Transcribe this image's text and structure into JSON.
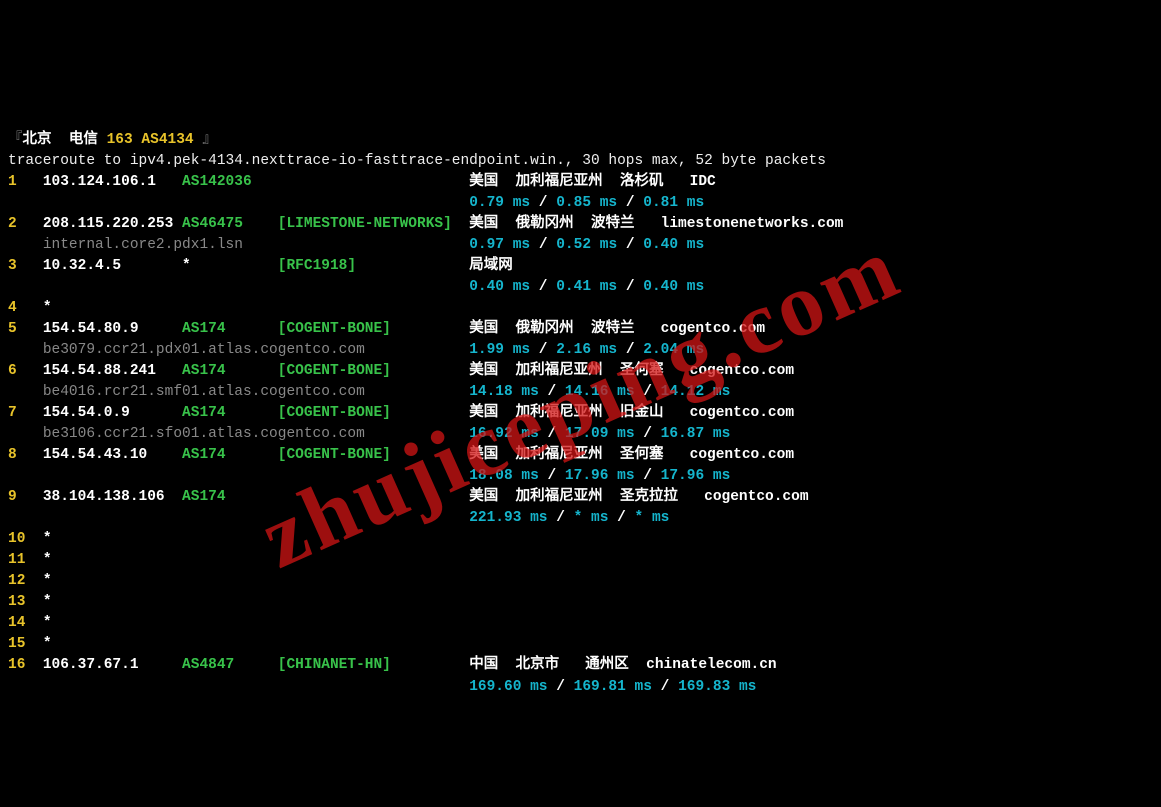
{
  "watermark": "zhujiceping.com",
  "title_prefix": "『",
  "title_city": "北京",
  "title_isp": "电信",
  "title_asn": "163 AS4134",
  "title_suffix": " 』",
  "traceroute_header": "traceroute to ipv4.pek-4134.nexttrace-io-fasttrace-endpoint.win., 30 hops max, 52 byte packets",
  "hops": [
    {
      "n": "1",
      "ip": "103.124.106.1",
      "asn": "AS142036",
      "bracket": "",
      "loc": "美国  加利福尼亚州  洛杉矶   IDC",
      "ptr": "",
      "t1": "0.79 ms",
      "t2": "0.85 ms",
      "t3": "0.81 ms"
    },
    {
      "n": "2",
      "ip": "208.115.220.253",
      "asn": "AS46475",
      "bracket": "[LIMESTONE-NETWORKS]",
      "loc": "美国  俄勒冈州  波特兰   limestonenetworks.com",
      "ptr": "internal.core2.pdx1.lsn",
      "t1": "0.97 ms",
      "t2": "0.52 ms",
      "t3": "0.40 ms"
    },
    {
      "n": "3",
      "ip": "10.32.4.5",
      "asn": "*",
      "bracket": "[RFC1918]",
      "loc": "局域网",
      "ptr": "",
      "t1": "0.40 ms",
      "t2": "0.41 ms",
      "t3": "0.40 ms"
    },
    {
      "n": "4",
      "ip": "*",
      "asn": "",
      "bracket": "",
      "loc": "",
      "ptr": "",
      "t1": "",
      "t2": "",
      "t3": ""
    },
    {
      "n": "5",
      "ip": "154.54.80.9",
      "asn": "AS174",
      "bracket": "[COGENT-BONE]",
      "loc": "美国  俄勒冈州  波特兰   cogentco.com",
      "ptr": "be3079.ccr21.pdx01.atlas.cogentco.com",
      "t1": "1.99 ms",
      "t2": "2.16 ms",
      "t3": "2.04 ms"
    },
    {
      "n": "6",
      "ip": "154.54.88.241",
      "asn": "AS174",
      "bracket": "[COGENT-BONE]",
      "loc": "美国  加利福尼亚州  圣何塞   cogentco.com",
      "ptr": "be4016.rcr21.smf01.atlas.cogentco.com",
      "t1": "14.18 ms",
      "t2": "14.16 ms",
      "t3": "14.12 ms"
    },
    {
      "n": "7",
      "ip": "154.54.0.9",
      "asn": "AS174",
      "bracket": "[COGENT-BONE]",
      "loc": "美国  加利福尼亚州  旧金山   cogentco.com",
      "ptr": "be3106.ccr21.sfo01.atlas.cogentco.com",
      "t1": "16.92 ms",
      "t2": "17.09 ms",
      "t3": "16.87 ms"
    },
    {
      "n": "8",
      "ip": "154.54.43.10",
      "asn": "AS174",
      "bracket": "[COGENT-BONE]",
      "loc": "美国  加利福尼亚州  圣何塞   cogentco.com",
      "ptr": "",
      "t1": "18.08 ms",
      "t2": "17.96 ms",
      "t3": "17.96 ms"
    },
    {
      "n": "9",
      "ip": "38.104.138.106",
      "asn": "AS174",
      "bracket": "",
      "loc": "美国  加利福尼亚州  圣克拉拉   cogentco.com",
      "ptr": "",
      "t1": "221.93 ms",
      "t2": "* ms",
      "t3": "* ms"
    },
    {
      "n": "10",
      "ip": "*",
      "asn": "",
      "bracket": "",
      "loc": "",
      "ptr": "",
      "t1": "",
      "t2": "",
      "t3": ""
    },
    {
      "n": "11",
      "ip": "*",
      "asn": "",
      "bracket": "",
      "loc": "",
      "ptr": "",
      "t1": "",
      "t2": "",
      "t3": ""
    },
    {
      "n": "12",
      "ip": "*",
      "asn": "",
      "bracket": "",
      "loc": "",
      "ptr": "",
      "t1": "",
      "t2": "",
      "t3": ""
    },
    {
      "n": "13",
      "ip": "*",
      "asn": "",
      "bracket": "",
      "loc": "",
      "ptr": "",
      "t1": "",
      "t2": "",
      "t3": ""
    },
    {
      "n": "14",
      "ip": "*",
      "asn": "",
      "bracket": "",
      "loc": "",
      "ptr": "",
      "t1": "",
      "t2": "",
      "t3": ""
    },
    {
      "n": "15",
      "ip": "*",
      "asn": "",
      "bracket": "",
      "loc": "",
      "ptr": "",
      "t1": "",
      "t2": "",
      "t3": ""
    },
    {
      "n": "16",
      "ip": "106.37.67.1",
      "asn": "AS4847",
      "bracket": "[CHINANET-HN]",
      "loc": "中国  北京市   通州区  chinatelecom.cn",
      "ptr": "",
      "t1": "169.60 ms",
      "t2": "169.81 ms",
      "t3": "169.83 ms"
    }
  ]
}
